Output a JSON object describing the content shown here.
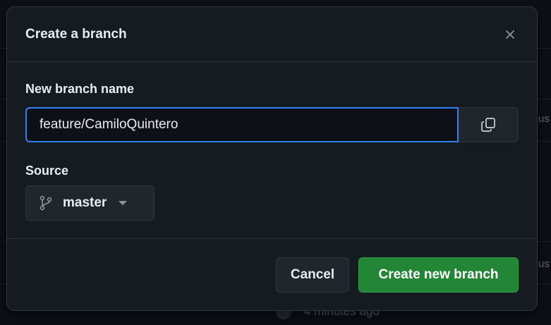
{
  "background": {
    "right_fragment_1": "us",
    "right_fragment_2": "us",
    "timestamp": "4 minutes ago"
  },
  "dialog": {
    "title": "Create a branch",
    "close_icon": "close-icon"
  },
  "form": {
    "branch_name_label": "New branch name",
    "branch_name_value": "feature/CamiloQuintero",
    "copy_icon": "copy-icon",
    "source_label": "Source",
    "source_value": "master",
    "source_icon": "git-branch-icon"
  },
  "footer": {
    "cancel_label": "Cancel",
    "create_label": "Create new branch"
  },
  "colors": {
    "background": "#0d1117",
    "dialog": "#161b22",
    "border": "#30363d",
    "focus": "#2f81f7",
    "primary": "#238636",
    "spellcheck": "#f85149"
  }
}
